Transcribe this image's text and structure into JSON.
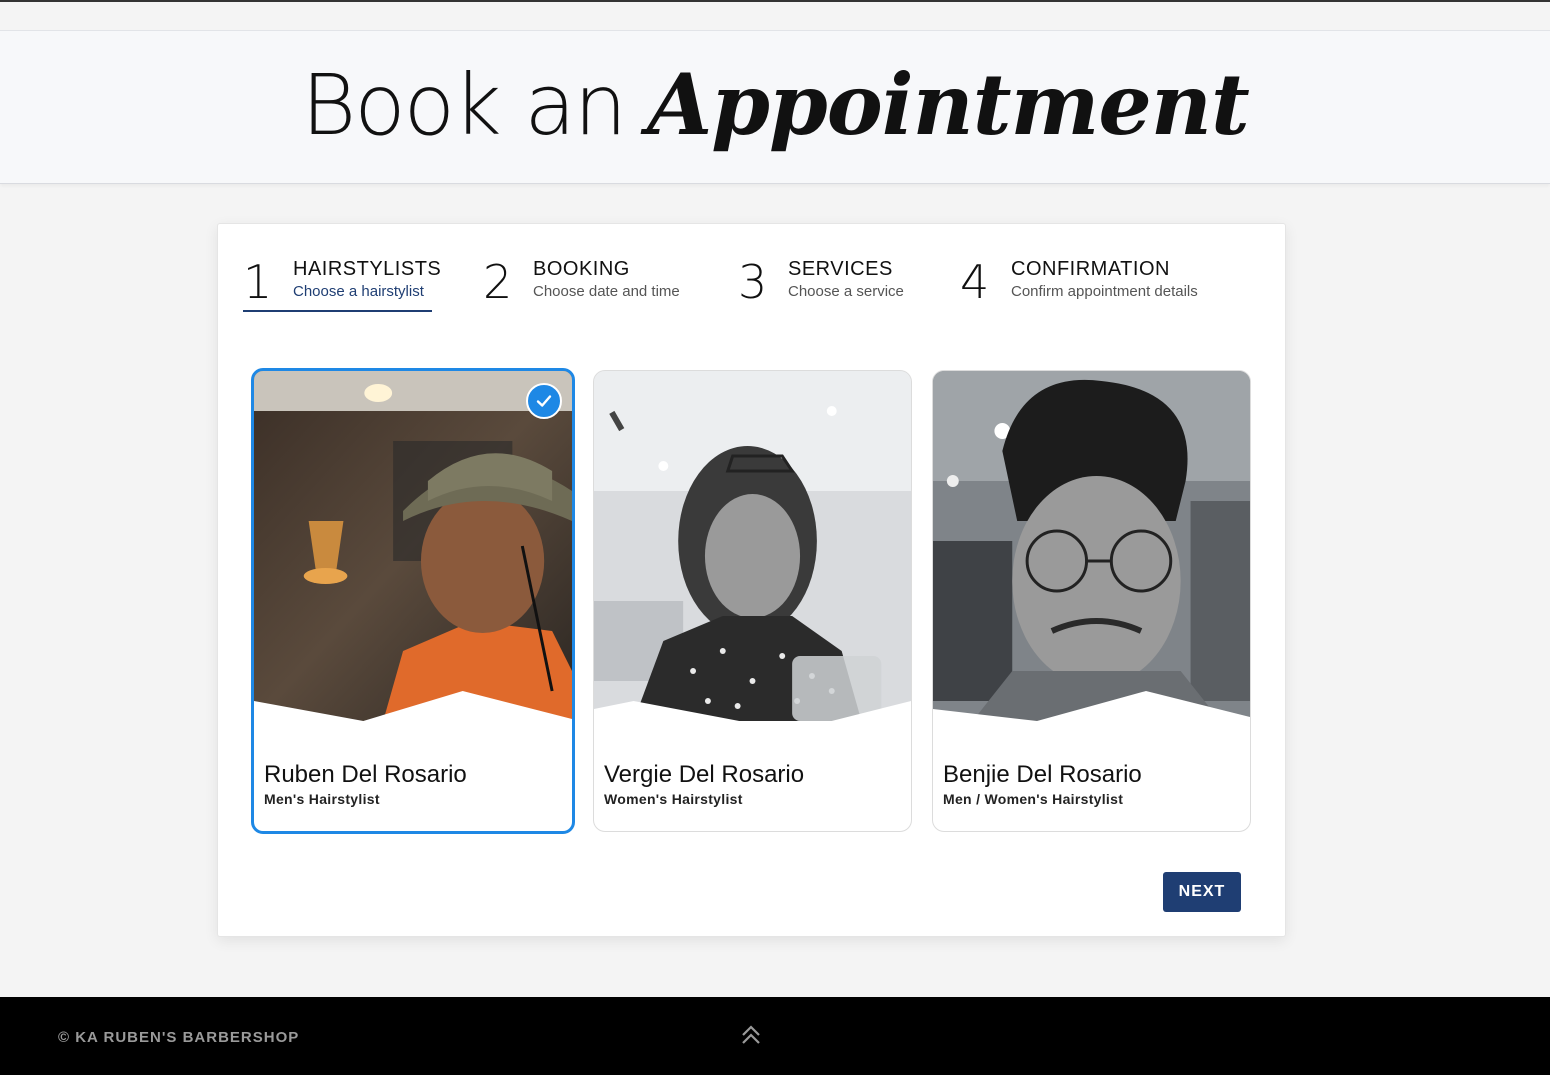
{
  "header": {
    "title_plain": "Book an",
    "title_emphasis": "Appointment"
  },
  "steps": [
    {
      "number": "1",
      "title": "HAIRSTYLISTS",
      "subtitle": "Choose a hairstylist",
      "active": true
    },
    {
      "number": "2",
      "title": "BOOKING",
      "subtitle": "Choose date and time",
      "active": false
    },
    {
      "number": "3",
      "title": "SERVICES",
      "subtitle": "Choose a service",
      "active": false
    },
    {
      "number": "4",
      "title": "CONFIRMATION",
      "subtitle": "Confirm appointment details",
      "active": false
    }
  ],
  "stylists": [
    {
      "name": "Ruben Del Rosario",
      "role": "Men's Hairstylist",
      "selected": true,
      "photo_icon": "man-with-hat-photo"
    },
    {
      "name": "Vergie Del Rosario",
      "role": "Women's Hairstylist",
      "selected": false,
      "photo_icon": "woman-portrait-photo"
    },
    {
      "name": "Benjie Del Rosario",
      "role": "Men / Women's Hairstylist",
      "selected": false,
      "photo_icon": "man-with-glasses-photo"
    }
  ],
  "actions": {
    "next_label": "NEXT"
  },
  "footer": {
    "copyright": "© KA RUBEN'S BARBERSHOP",
    "scroll_icon": "double-chevron-up-icon"
  },
  "colors": {
    "accent": "#1f3e73",
    "selected_border": "#1e88e5",
    "footer_bg": "#000000"
  }
}
